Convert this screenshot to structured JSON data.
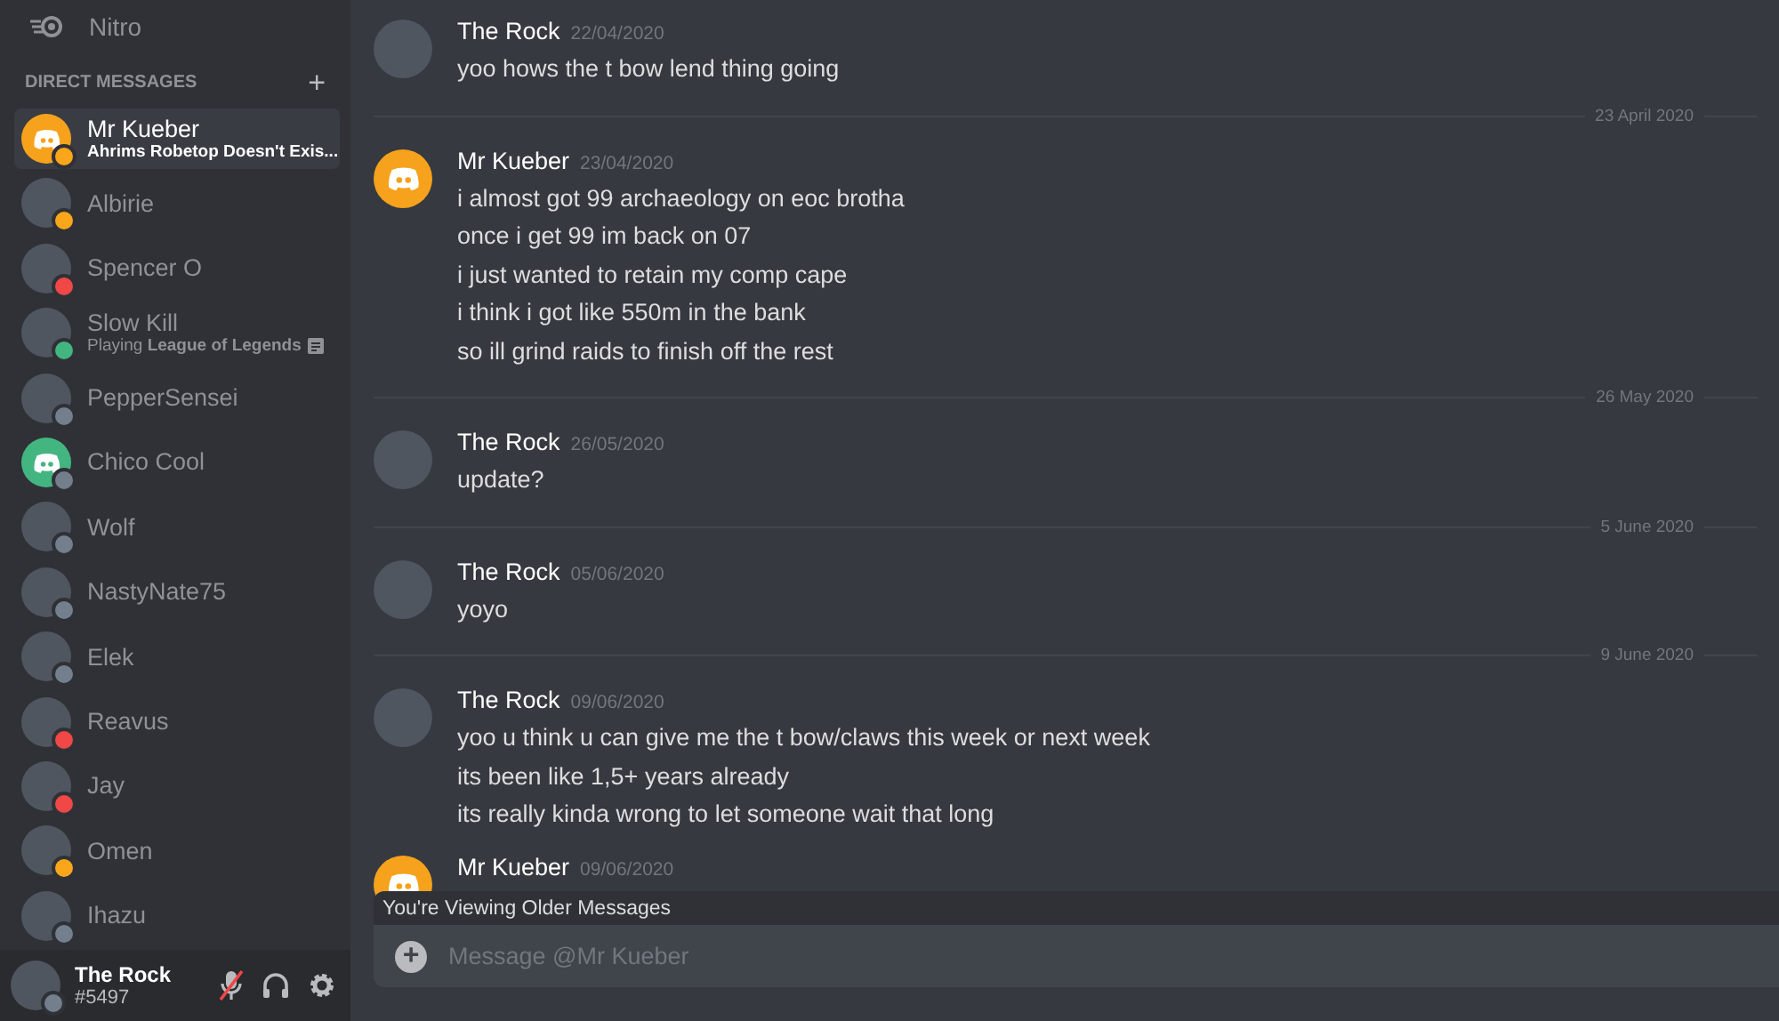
{
  "sidebar": {
    "nitro": {
      "label": "Nitro"
    },
    "dm_header": {
      "label": "DIRECT MESSAGES",
      "add": "+"
    },
    "items": [
      {
        "name": "Mr Kueber",
        "subtitle": "Ahrims Robetop Doesn't Exis...",
        "status": {
          "color": "#faa61a"
        },
        "avatar": {
          "kind": "logo",
          "color": "#f6a21d"
        },
        "selected": true
      },
      {
        "name": "Albirie",
        "status": {
          "color": "#faa61a"
        },
        "avatar": {
          "kind": "photo"
        },
        "selected": false
      },
      {
        "name": "Spencer O",
        "status": {
          "color": "#f04747"
        },
        "avatar": {
          "kind": "photo"
        },
        "selected": false
      },
      {
        "name": "Slow Kill",
        "subtitle": "Playing **League of Legends**",
        "status": {
          "color": "#43b581"
        },
        "avatar": {
          "kind": "photo"
        },
        "selected": false
      },
      {
        "name": "PepperSensei",
        "status": {
          "color": "#747f8d"
        },
        "avatar": {
          "kind": "photo"
        },
        "selected": false
      },
      {
        "name": "Chico Cool",
        "status": {
          "color": "#747f8d"
        },
        "avatar": {
          "kind": "logo",
          "color": "#43b581"
        },
        "selected": false
      },
      {
        "name": "Wolf",
        "status": {
          "color": "#747f8d"
        },
        "avatar": {
          "kind": "photo"
        },
        "selected": false
      },
      {
        "name": "NastyNate75",
        "status": {
          "color": "#747f8d"
        },
        "avatar": {
          "kind": "photo"
        },
        "selected": false
      },
      {
        "name": "Elek",
        "status": {
          "color": "#747f8d"
        },
        "avatar": {
          "kind": "photo"
        },
        "selected": false
      },
      {
        "name": "Reavus",
        "status": {
          "color": "#f04747"
        },
        "avatar": {
          "kind": "photo"
        },
        "selected": false
      },
      {
        "name": "Jay",
        "status": {
          "color": "#f04747"
        },
        "avatar": {
          "kind": "photo"
        },
        "selected": false
      },
      {
        "name": "Omen",
        "status": {
          "color": "#faa61a"
        },
        "avatar": {
          "kind": "photo"
        },
        "selected": false
      },
      {
        "name": "Ihazu",
        "status": {
          "color": "#747f8d"
        },
        "avatar": {
          "kind": "photo"
        },
        "selected": false
      }
    ]
  },
  "user_panel": {
    "name": "The Rock",
    "tag": "#5497",
    "status": {
      "color": "#747f8d"
    },
    "mic_muted": true
  },
  "messages": [
    {
      "kind": "group",
      "author": "The Rock",
      "date": "22/04/2020",
      "avatar": {
        "kind": "photo"
      },
      "lines": [
        "yoo hows the t bow lend thing going"
      ]
    },
    {
      "kind": "divider",
      "date": "23 April 2020"
    },
    {
      "kind": "group",
      "author": "Mr Kueber",
      "date": "23/04/2020",
      "avatar": {
        "kind": "logo",
        "color": "#f6a21d"
      },
      "lines": [
        "i almost got 99 archaeology on eoc brotha",
        "once i get 99 im back on 07",
        "i just wanted to retain my comp cape",
        "i think i got like 550m in the bank",
        "so ill grind raids to finish off the rest"
      ]
    },
    {
      "kind": "divider",
      "date": "26 May 2020"
    },
    {
      "kind": "group",
      "author": "The Rock",
      "date": "26/05/2020",
      "avatar": {
        "kind": "photo"
      },
      "lines": [
        "update?"
      ]
    },
    {
      "kind": "divider",
      "date": "5 June 2020"
    },
    {
      "kind": "group",
      "author": "The Rock",
      "date": "05/06/2020",
      "avatar": {
        "kind": "photo"
      },
      "lines": [
        "yoyo"
      ]
    },
    {
      "kind": "divider",
      "date": "9 June 2020"
    },
    {
      "kind": "group",
      "author": "The Rock",
      "date": "09/06/2020",
      "avatar": {
        "kind": "photo"
      },
      "lines": [
        "yoo u think u can give me the t bow/claws this week or next week",
        "its been like 1,5+ years already",
        "its really kinda wrong to let someone wait that long"
      ]
    },
    {
      "kind": "group",
      "author": "Mr Kueber",
      "date": "09/06/2020",
      "avatar": {
        "kind": "logo",
        "color": "#f6a21d"
      }
    }
  ],
  "older_banner": "You're Viewing Older Messages",
  "composer": {
    "add": "+",
    "placeholder": "Message @Mr Kueber"
  }
}
